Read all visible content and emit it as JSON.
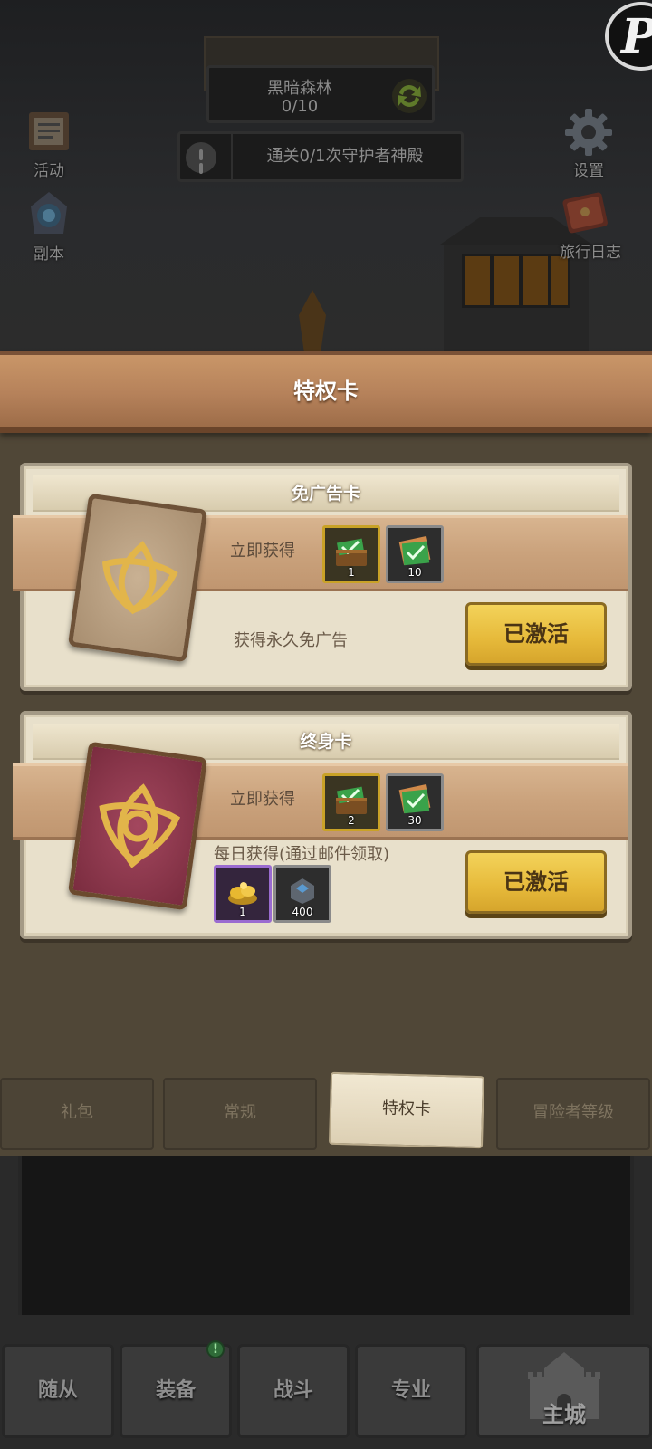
{
  "stage": {
    "name": "黑暗森林",
    "progress": "0/10"
  },
  "quest": {
    "text": "通关0/1次守护者神殿"
  },
  "side_buttons": {
    "events": "活动",
    "dungeon": "副本",
    "settings": "设置",
    "journal": "旅行日志"
  },
  "corner_badge": "P",
  "panel": {
    "title": "特权卡"
  },
  "cards": [
    {
      "title": "免广告卡",
      "instant_label": "立即获得",
      "instant_rewards": [
        {
          "icon": "ticket-chest-icon",
          "qty": "1"
        },
        {
          "icon": "ticket-icon",
          "qty": "10"
        }
      ],
      "description": "获得永久免广告",
      "button": "已激活"
    },
    {
      "title": "终身卡",
      "instant_label": "立即获得",
      "instant_rewards": [
        {
          "icon": "ticket-chest-icon",
          "qty": "2"
        },
        {
          "icon": "ticket-icon",
          "qty": "30"
        }
      ],
      "daily_label": "每日获得(通过邮件领取)",
      "daily_rewards": [
        {
          "icon": "gold-pile-icon",
          "qty": "1"
        },
        {
          "icon": "gem-stone-icon",
          "qty": "400"
        }
      ],
      "button": "已激活"
    }
  ],
  "tabs": [
    {
      "label": "礼包",
      "active": false
    },
    {
      "label": "常规",
      "active": false
    },
    {
      "label": "特权卡",
      "active": true
    },
    {
      "label": "冒险者等级",
      "active": false
    }
  ],
  "bottom_nav": [
    {
      "label": "随从"
    },
    {
      "label": "装备",
      "badge": "!"
    },
    {
      "label": "战斗"
    },
    {
      "label": "专业"
    },
    {
      "label": "主城"
    }
  ],
  "colors": {
    "activate_button": "#e6b93a",
    "panel_header": "#b5815a",
    "card_bg": "#e8e0cb",
    "lifetime_card_art": "#7a2c3f",
    "noad_card_art": "#a88e70"
  }
}
